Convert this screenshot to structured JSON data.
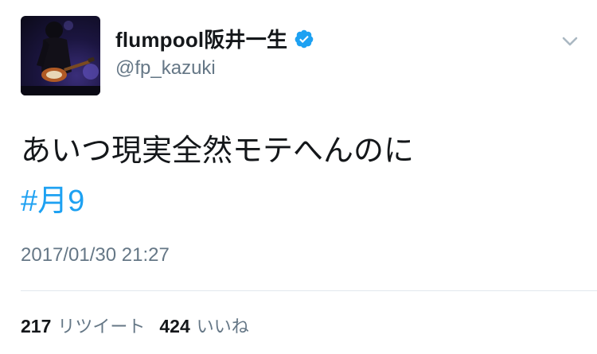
{
  "user": {
    "display_name": "flumpool阪井一生",
    "handle": "@fp_kazuki",
    "verified": true,
    "avatar_icon": "user-avatar-guitarist"
  },
  "tweet": {
    "text": "あいつ現実全然モテへんのに",
    "hashtag": "#月9",
    "timestamp": "2017/01/30 21:27"
  },
  "stats": {
    "retweets_count": "217",
    "retweets_label": "リツイート",
    "likes_count": "424",
    "likes_label": "いいね"
  },
  "colors": {
    "accent": "#1da1f2",
    "text": "#14171a",
    "secondary": "#657786",
    "divider": "#e1e8ed"
  },
  "icons": {
    "verified": "verified-badge-icon",
    "more": "chevron-down-icon"
  }
}
